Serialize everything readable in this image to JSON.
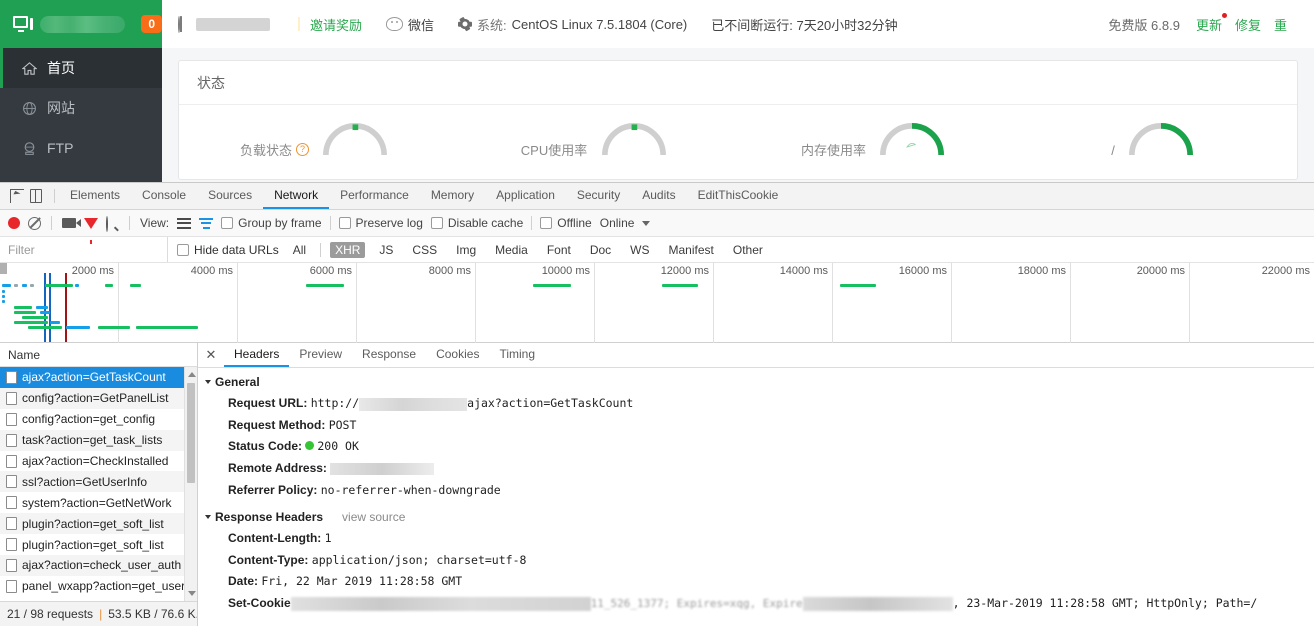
{
  "topbar": {
    "brand_icon": "monitor-icon",
    "badge_count": "0",
    "user_icon": "person-icon",
    "invite_icon": "gift-icon",
    "invite_label": "邀请奖励",
    "wechat_icon": "wechat-icon",
    "wechat_label": "微信",
    "system_icon": "gear-icon",
    "system_label": "系统:",
    "system_value": "CentOS Linux 7.5.1804 (Core)",
    "uptime_label": "已不间断运行: 7天20小时32分钟",
    "version_label": "免费版 6.8.9",
    "update_label": "更新",
    "repair_label": "修复",
    "more_label": "重"
  },
  "sidebar": {
    "items": [
      {
        "label": "首页",
        "icon": "home-icon",
        "active": true
      },
      {
        "label": "网站",
        "icon": "globe-icon",
        "active": false
      },
      {
        "label": "FTP",
        "icon": "ftp-icon",
        "active": false
      }
    ]
  },
  "panel": {
    "card_title": "状态",
    "gauges": [
      {
        "label": "负载状态",
        "help_icon": "question-icon",
        "percent": 3
      },
      {
        "label": "CPU使用率",
        "help_icon": "",
        "percent": 3
      },
      {
        "label": "内存使用率",
        "help_icon": "",
        "percent": 45
      },
      {
        "label": "/",
        "help_icon": "",
        "percent": 45
      }
    ]
  },
  "devtools": {
    "inspect_icon": "inspect-element-icon",
    "device_icon": "toggle-device-toolbar-icon",
    "tabs": [
      {
        "label": "Elements",
        "active": false
      },
      {
        "label": "Console",
        "active": false
      },
      {
        "label": "Sources",
        "active": false
      },
      {
        "label": "Network",
        "active": true
      },
      {
        "label": "Performance",
        "active": false
      },
      {
        "label": "Memory",
        "active": false
      },
      {
        "label": "Application",
        "active": false
      },
      {
        "label": "Security",
        "active": false
      },
      {
        "label": "Audits",
        "active": false
      },
      {
        "label": "EditThisCookie",
        "active": false
      }
    ],
    "toolbar": {
      "record_icon": "record-button",
      "clear_icon": "clear-icon",
      "camera_icon": "capture-screenshots-icon",
      "filter_icon": "filter-icon",
      "search_icon": "search-icon",
      "view_label": "View:",
      "list_view_icon": "list-view-icon",
      "waterfall_view_icon": "waterfall-view-icon",
      "group_by_frame_label": "Group by frame",
      "preserve_log_label": "Preserve log",
      "disable_cache_label": "Disable cache",
      "offline_label": "Offline",
      "throttle_value": "Online",
      "throttle_caret_icon": "chevron-down-icon"
    },
    "filter_row": {
      "filter_placeholder": "Filter",
      "hide_data_urls_label": "Hide data URLs",
      "types": [
        {
          "label": "All",
          "selected": false
        },
        {
          "label": "XHR",
          "selected": true
        },
        {
          "label": "JS",
          "selected": false
        },
        {
          "label": "CSS",
          "selected": false
        },
        {
          "label": "Img",
          "selected": false
        },
        {
          "label": "Media",
          "selected": false
        },
        {
          "label": "Font",
          "selected": false
        },
        {
          "label": "Doc",
          "selected": false
        },
        {
          "label": "WS",
          "selected": false
        },
        {
          "label": "Manifest",
          "selected": false
        },
        {
          "label": "Other",
          "selected": false
        }
      ]
    },
    "overview": {
      "ticks": [
        "2000 ms",
        "4000 ms",
        "6000 ms",
        "8000 ms",
        "10000 ms",
        "12000 ms",
        "14000 ms",
        "16000 ms",
        "18000 ms",
        "20000 ms",
        "22000 ms"
      ],
      "dom_content_loaded_color": "#1565c0",
      "load_event_color": "#a31515",
      "request_bar_color": "#16c060",
      "secondary_bar_color": "#14a0e8"
    },
    "requests": {
      "name_column": "Name",
      "rows": [
        {
          "name": "ajax?action=GetTaskCount",
          "selected": true
        },
        {
          "name": "config?action=GetPanelList",
          "selected": false
        },
        {
          "name": "config?action=get_config",
          "selected": false
        },
        {
          "name": "task?action=get_task_lists",
          "selected": false
        },
        {
          "name": "ajax?action=CheckInstalled",
          "selected": false
        },
        {
          "name": "ssl?action=GetUserInfo",
          "selected": false
        },
        {
          "name": "system?action=GetNetWork",
          "selected": false
        },
        {
          "name": "plugin?action=get_soft_list",
          "selected": false
        },
        {
          "name": "plugin?action=get_soft_list",
          "selected": false
        },
        {
          "name": "ajax?action=check_user_auth",
          "selected": false
        },
        {
          "name": "panel_wxapp?action=get_user",
          "selected": false
        }
      ],
      "status_requests": "21 / 98 requests",
      "status_sep": "|",
      "status_transfer": "53.5 KB / 76.6 K..."
    },
    "detail": {
      "close_icon": "close-icon",
      "tabs": [
        {
          "label": "Headers",
          "active": true
        },
        {
          "label": "Preview",
          "active": false
        },
        {
          "label": "Response",
          "active": false
        },
        {
          "label": "Cookies",
          "active": false
        },
        {
          "label": "Timing",
          "active": false
        }
      ],
      "general": {
        "section_title": "General",
        "request_url_key": "Request URL:",
        "request_url_prefix": "http://",
        "request_url_suffix": "ajax?action=GetTaskCount",
        "request_method_key": "Request Method:",
        "request_method_value": "POST",
        "status_code_key": "Status Code:",
        "status_code_value": "200 OK",
        "status_icon": "green-status-dot",
        "remote_address_key": "Remote Address:",
        "remote_address_value": "",
        "referrer_policy_key": "Referrer Policy:",
        "referrer_policy_value": "no-referrer-when-downgrade"
      },
      "response_headers": {
        "section_title": "Response Headers",
        "view_source_label": "view source",
        "rows": [
          {
            "key": "Content-Length:",
            "value": "1"
          },
          {
            "key": "Content-Type:",
            "value": "application/json; charset=utf-8"
          },
          {
            "key": "Date:",
            "value": "Fri, 22 Mar 2019 11:28:58 GMT"
          }
        ],
        "set_cookie_key": "Set-Cookie",
        "set_cookie_tail": ", 23-Mar-2019 11:28:58 GMT; HttpOnly; Path=/"
      }
    }
  }
}
